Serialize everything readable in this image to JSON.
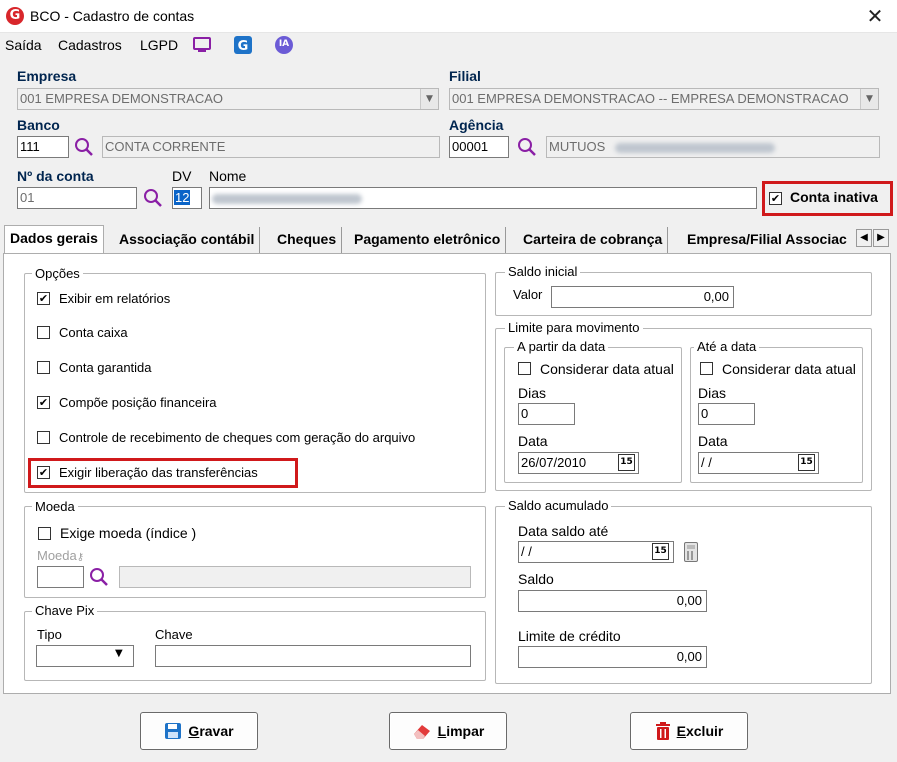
{
  "window": {
    "title": "BCO - Cadastro de contas",
    "close": "✕",
    "logo": "G"
  },
  "menu": {
    "items": [
      "Saída",
      "Cadastros",
      "LGPD"
    ],
    "ia_label": "IA"
  },
  "empresa": {
    "label": "Empresa",
    "value": "001 EMPRESA DEMONSTRACAO"
  },
  "filial": {
    "label": "Filial",
    "value": "001 EMPRESA DEMONSTRACAO -- EMPRESA DEMONSTRACAO"
  },
  "banco": {
    "label": "Banco",
    "code": "111",
    "desc": "CONTA CORRENTE"
  },
  "agencia": {
    "label": "Agência",
    "code": "00001",
    "desc": "MUTUOS"
  },
  "conta": {
    "label": "Nº da conta",
    "value": "01",
    "dv_label": "DV",
    "dv_value": "12",
    "nome_label": "Nome"
  },
  "conta_inativa": {
    "label": "Conta inativa",
    "checked": true
  },
  "tabs": [
    "Dados gerais",
    "Associação contábil",
    "Cheques",
    "Pagamento eletrônico",
    "Carteira de cobrança",
    "Empresa/Filial Associac"
  ],
  "opcoes": {
    "title": "Opções",
    "items": [
      {
        "label": "Exibir em relatórios",
        "checked": true
      },
      {
        "label": "Conta caixa",
        "checked": false
      },
      {
        "label": "Conta garantida",
        "checked": false
      },
      {
        "label": "Compõe posição financeira",
        "checked": true
      },
      {
        "label": "Controle de recebimento de cheques com geração do arquivo",
        "checked": false
      },
      {
        "label": "Exigir liberação das transferências",
        "checked": true
      }
    ]
  },
  "moeda": {
    "title": "Moeda",
    "exige_label": "Exige moeda (índice )",
    "exige_checked": false,
    "moeda_label": "Moeda"
  },
  "chave_pix": {
    "title": "Chave Pix",
    "tipo_label": "Tipo",
    "chave_label": "Chave"
  },
  "saldo_inicial": {
    "title": "Saldo inicial",
    "valor_label": "Valor",
    "valor": "0,00"
  },
  "limite": {
    "title": "Limite para movimento",
    "a_partir": {
      "title": "A partir da data",
      "considerar": "Considerar data atual",
      "dias_label": "Dias",
      "dias": "0",
      "data_label": "Data",
      "data": "26/07/2010"
    },
    "ate": {
      "title": "Até a data",
      "considerar": "Considerar data atual",
      "dias_label": "Dias",
      "dias": "0",
      "data_label": "Data",
      "data": " / /"
    },
    "calendar_day": "15"
  },
  "saldo_acumulado": {
    "title": "Saldo acumulado",
    "data_label": "Data saldo até",
    "data": " / /",
    "saldo_label": "Saldo",
    "saldo": "0,00",
    "limite_label": "Limite de crédito",
    "limite": "0,00"
  },
  "buttons": {
    "gravar_first": "G",
    "gravar_rest": "ravar",
    "limpar_first": "L",
    "limpar_rest": "impar",
    "excluir_first": "E",
    "excluir_rest": "xcluir"
  },
  "colors": {
    "accent_label": "#00254f",
    "highlight": "#d0191b",
    "selection": "#0a64c8"
  }
}
